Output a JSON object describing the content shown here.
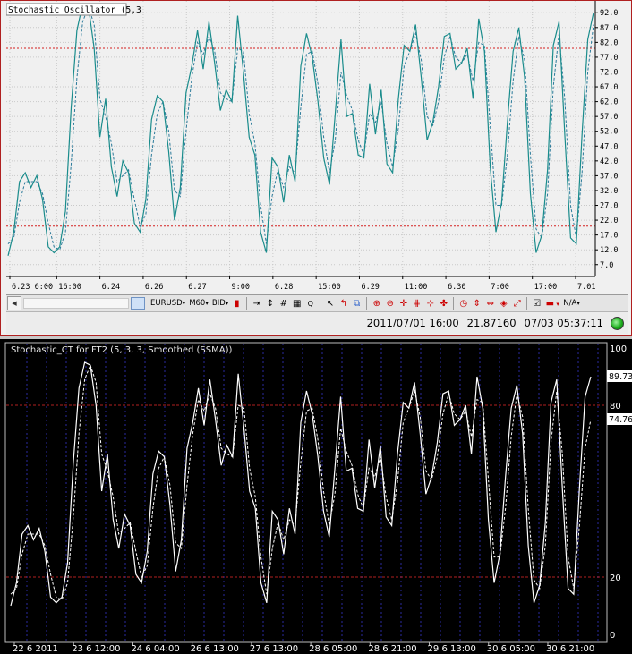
{
  "top_panel": {
    "title": "Stochastic Oscillator (5,3",
    "toolbar": {
      "symbol": "EURUSD",
      "timeframe": "M60",
      "price_type": "BID",
      "na_label": "N/A"
    },
    "status": {
      "datetime": "2011/07/01 16:00",
      "value": "21.87160",
      "server_time": "07/03 05:37:11"
    }
  },
  "bottom_panel": {
    "title": "Stochastic_CT for FT2 (5, 3, 3, Smoothed (SSMA))",
    "main_badge": "89.73",
    "signal_badge": "74.76"
  },
  "colors": {
    "top_main_line": "#1a8c8c",
    "top_signal_line": "#2a7a9a",
    "top_level_line": "#d42020",
    "bottom_lines": "#ffffff",
    "bottom_level_line": "#b02020",
    "bottom_period_sep": "#2a2aa0"
  },
  "chart_data": [
    {
      "type": "line",
      "title": "Stochastic Oscillator (5,3",
      "xlabel": "",
      "ylabel": "",
      "ylim": [
        3,
        96
      ],
      "y_ticks": [
        "92.0",
        "87.0",
        "82.0",
        "77.0",
        "72.0",
        "67.0",
        "62.0",
        "57.0",
        "52.0",
        "47.0",
        "42.0",
        "37.0",
        "32.0",
        "27.0",
        "22.0",
        "17.0",
        "12.0",
        "7.0"
      ],
      "x_ticks": [
        "6.23 6:00",
        "16:00",
        "6.24",
        "6.26",
        "6.27",
        "9:00",
        "6.28",
        "15:00",
        "6.29",
        "11:00",
        "6.30",
        "7:00",
        "17:00",
        "7.01"
      ],
      "levels": [
        80,
        20
      ],
      "series": [
        {
          "values": [
            10,
            18,
            35,
            38,
            33,
            37,
            29,
            13,
            11,
            13,
            25,
            60,
            86,
            95,
            94,
            80,
            50,
            63,
            40,
            30,
            42,
            38,
            21,
            18,
            29,
            56,
            64,
            62,
            45,
            22,
            33,
            65,
            74,
            86,
            73,
            89,
            75,
            59,
            66,
            62,
            91,
            72,
            50,
            44,
            18,
            11,
            43,
            40,
            28,
            44,
            35,
            74,
            85,
            77,
            62,
            43,
            34,
            58,
            83,
            57,
            58,
            44,
            43,
            68,
            51,
            66,
            41,
            38,
            63,
            81,
            79,
            88,
            70,
            49,
            55,
            67,
            84,
            85,
            73,
            75,
            80,
            63,
            90,
            79,
            40,
            18,
            28,
            55,
            79,
            87,
            70,
            31,
            11,
            17,
            39,
            81,
            89,
            51,
            16,
            14,
            51,
            83,
            92
          ]
        },
        {
          "values": [
            14,
            16,
            28,
            35,
            35,
            35,
            31,
            21,
            13,
            12,
            18,
            41,
            70,
            89,
            94,
            88,
            63,
            57,
            48,
            35,
            37,
            39,
            29,
            20,
            24,
            44,
            58,
            62,
            52,
            32,
            30,
            52,
            70,
            82,
            78,
            84,
            79,
            65,
            63,
            62,
            80,
            79,
            58,
            48,
            27,
            14,
            30,
            39,
            33,
            40,
            38,
            60,
            78,
            79,
            68,
            50,
            38,
            49,
            72,
            64,
            59,
            49,
            44,
            58,
            55,
            62,
            48,
            40,
            53,
            74,
            79,
            85,
            76,
            57,
            54,
            62,
            77,
            84,
            77,
            75,
            78,
            69,
            82,
            81,
            54,
            27,
            27,
            44,
            69,
            84,
            76,
            44,
            19,
            16,
            31,
            67,
            85,
            63,
            27,
            16,
            38,
            72,
            88
          ]
        }
      ]
    },
    {
      "type": "line",
      "title": "Stochastic_CT for FT2 (5, 3, 3, Smoothed (SSMA))",
      "xlabel": "",
      "ylabel": "",
      "ylim": [
        0,
        100
      ],
      "y_ticks": [
        "100",
        "80",
        "20",
        "0"
      ],
      "x_ticks": [
        "22 6 2011",
        "23 6 12:00",
        "24 6 04:00",
        "26 6 13:00",
        "27 6 13:00",
        "28 6 05:00",
        "28 6 21:00",
        "29 6 13:00",
        "30 6 05:00",
        "30 6 21:00"
      ],
      "levels": [
        80,
        20
      ],
      "series": [
        {
          "values": [
            10,
            18,
            35,
            38,
            33,
            37,
            29,
            13,
            11,
            13,
            25,
            60,
            86,
            95,
            94,
            80,
            50,
            63,
            40,
            30,
            42,
            38,
            21,
            18,
            29,
            56,
            64,
            62,
            45,
            22,
            33,
            65,
            74,
            86,
            73,
            89,
            75,
            59,
            66,
            62,
            91,
            72,
            50,
            44,
            18,
            11,
            43,
            40,
            28,
            44,
            35,
            74,
            85,
            77,
            62,
            43,
            34,
            58,
            83,
            57,
            58,
            44,
            43,
            68,
            51,
            66,
            41,
            38,
            63,
            81,
            79,
            88,
            70,
            49,
            55,
            67,
            84,
            85,
            73,
            75,
            80,
            63,
            90,
            79,
            40,
            18,
            28,
            55,
            79,
            87,
            70,
            31,
            11,
            17,
            39,
            81,
            89,
            51,
            16,
            14,
            51,
            83,
            90
          ]
        },
        {
          "values": [
            14,
            16,
            28,
            35,
            35,
            35,
            31,
            21,
            13,
            12,
            18,
            41,
            70,
            89,
            94,
            88,
            63,
            57,
            48,
            35,
            37,
            39,
            29,
            20,
            24,
            44,
            58,
            62,
            52,
            32,
            30,
            52,
            70,
            82,
            78,
            84,
            79,
            65,
            63,
            62,
            80,
            79,
            58,
            48,
            27,
            14,
            30,
            39,
            33,
            40,
            38,
            60,
            78,
            79,
            68,
            50,
            38,
            49,
            72,
            64,
            59,
            49,
            44,
            58,
            55,
            62,
            48,
            40,
            53,
            74,
            79,
            85,
            76,
            57,
            54,
            62,
            77,
            84,
            77,
            75,
            78,
            69,
            82,
            81,
            54,
            27,
            27,
            44,
            69,
            84,
            76,
            44,
            19,
            16,
            31,
            67,
            85,
            63,
            27,
            16,
            38,
            65,
            75
          ]
        }
      ]
    }
  ]
}
